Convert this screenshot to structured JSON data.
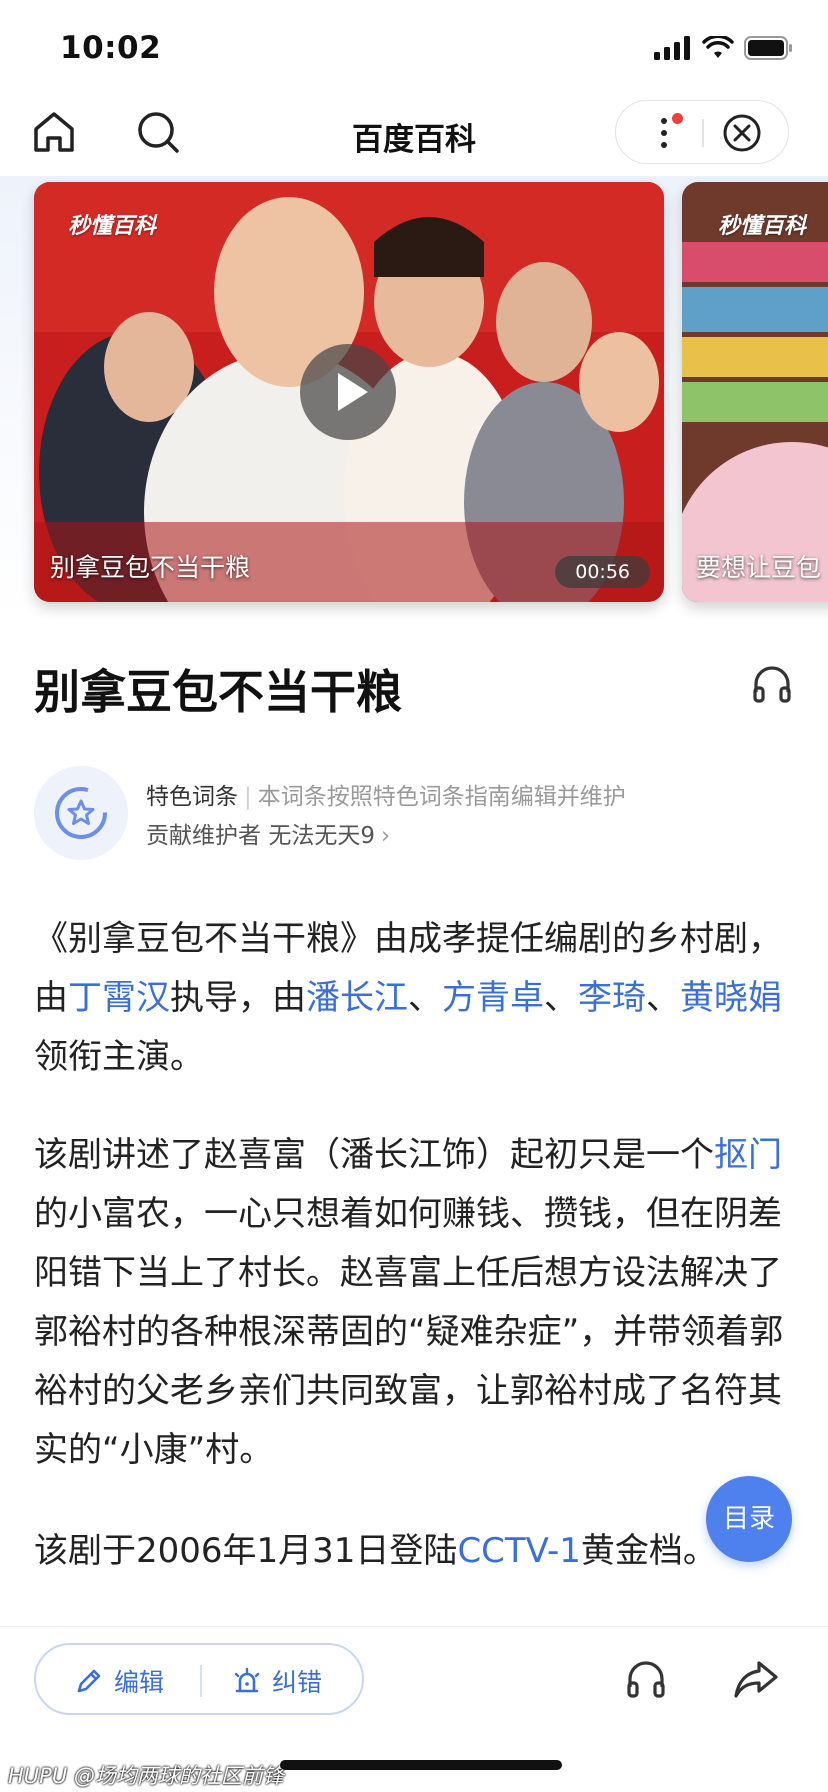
{
  "status_bar": {
    "time": "10:02"
  },
  "nav": {
    "title": "百度百科"
  },
  "videos": [
    {
      "watermark": "秒懂百科",
      "caption": "别拿豆包不当干粮",
      "duration": "00:56"
    },
    {
      "watermark": "秒懂百科",
      "caption": "要想让豆包"
    }
  ],
  "entry": {
    "title": "别拿豆包不当干粮"
  },
  "feature": {
    "label": "特色词条",
    "description": "本词条按照特色词条指南编辑并维护",
    "contributor_label": "贡献维护者",
    "contributor_name": "无法无天9"
  },
  "paragraphs": {
    "p1": {
      "t1": "《别拿豆包不当干粮》由成孝提任编剧的乡村剧，由",
      "director": "丁霄汉",
      "t2": "执导，由",
      "actor1": "潘长江",
      "actor2": "方青卓",
      "actor3": "李琦",
      "actor4": "黄晓娟",
      "t3": "领衔主演。",
      "sep": "、"
    },
    "p2": {
      "t1": "该剧讲述了赵喜富（潘长江饰）起初只是一个",
      "link": "抠门",
      "t2": "的小富农，一心只想着如何赚钱、攒钱，但在阴差阳错下当上了村长。赵喜富上任后想方设法解决了郭裕村的各种根深蒂固的“疑难杂症”，并带领着郭裕村的父老乡亲们共同致富，让郭裕村成了名符其实的“小康”村。"
    },
    "p3": {
      "t1": "该剧于2006年1月31日登陆",
      "link": "CCTV-1",
      "t2": "黄金档。"
    }
  },
  "toc_label": "目录",
  "bottom_bar": {
    "edit_label": "编辑",
    "fix_label": "纠错"
  },
  "credit": "HUPU @场均两球的社区前锋",
  "colors": {
    "accent": "#3a6fd8",
    "toc": "#4e80ee",
    "notification_dot": "#f0403c"
  }
}
